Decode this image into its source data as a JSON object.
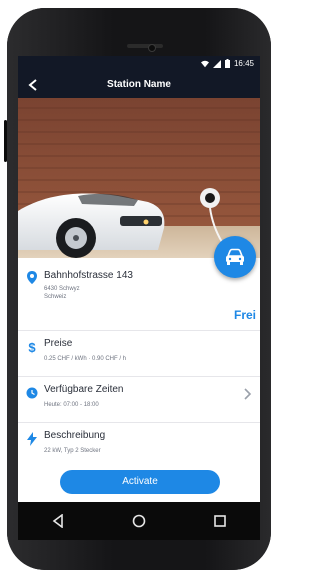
{
  "status_bar": {
    "time": "16:45"
  },
  "app_bar": {
    "title": "Station Name",
    "back_icon": "back-arrow-icon"
  },
  "location": {
    "street": "Bahnhofstrasse 143",
    "city": "6430 Schwyz",
    "country": "Schweiz",
    "availability": "Frei"
  },
  "prices": {
    "title": "Preise",
    "detail": "0.25 CHF / kWh · 0.90 CHF / h"
  },
  "times": {
    "title": "Verfügbare Zeiten",
    "detail": "Heute: 07:00 - 18:00"
  },
  "description": {
    "title": "Beschreibung",
    "detail": "22 kW, Typ 2 Stecker"
  },
  "actions": {
    "activate_label": "Activate"
  },
  "colors": {
    "accent": "#1e88e5",
    "app_bar": "#121826",
    "phone": "#1c1c1e"
  },
  "icons": [
    "back-arrow-icon",
    "wifi-icon",
    "signal-icon",
    "battery-icon",
    "car-icon",
    "location-pin-icon",
    "dollar-icon",
    "clock-icon",
    "lightning-icon",
    "chevron-right-icon",
    "nav-back-icon",
    "nav-home-icon",
    "nav-recents-icon"
  ]
}
